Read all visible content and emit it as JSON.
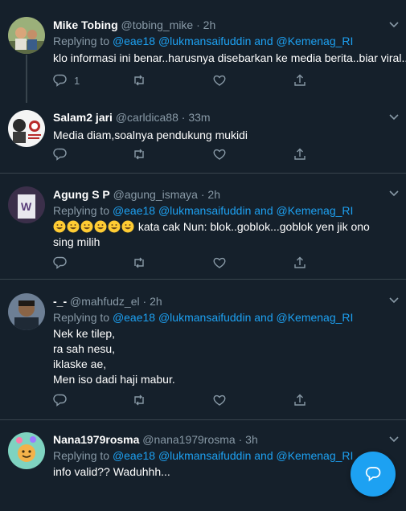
{
  "colors": {
    "background": "#15202b",
    "accent": "#1da1f2",
    "muted": "#8899a6",
    "divider": "#38444d"
  },
  "tweets": [
    {
      "name": "Mike Tobing",
      "handle": "@tobing_mike",
      "separator": "·",
      "time": "2h",
      "replying_prefix": "Replying to",
      "replying_to": "@eae18 @lukmansaifuddin and @Kemenag_RI",
      "lines": [
        "klo informasi ini benar..harusnya disebarkan ke media berita..biar viral.."
      ],
      "reply_count": "1"
    },
    {
      "name": "Salam2 jari",
      "handle": "@carldica88",
      "separator": "·",
      "time": "33m",
      "lines": [
        "Media diam,soalnya pendukung mukidi"
      ]
    },
    {
      "name": "Agung S P",
      "handle": "@agung_ismaya",
      "separator": "·",
      "time": "2h",
      "replying_prefix": "Replying to",
      "replying_to": "@eae18 @lukmansaifuddin and @Kemenag_RI",
      "emoji": [
        "grinning-face-emoji",
        "grinning-face-emoji",
        "grinning-face-emoji",
        "grinning-face-emoji",
        "grinning-face-emoji",
        "grinning-face-emoji"
      ],
      "lines": [
        "kata cak Nun: blok..goblok...goblok yen jik ono",
        "sing milih"
      ]
    },
    {
      "name": "-_-",
      "handle": "@mahfudz_el",
      "separator": "·",
      "time": "2h",
      "replying_prefix": "Replying to",
      "replying_to": "@eae18 @lukmansaifuddin and @Kemenag_RI",
      "lines": [
        "Nek ke tilep,",
        "ra sah nesu,",
        "iklaske ae,",
        "Men iso dadi haji mabur."
      ]
    },
    {
      "name": "Nana1979rosma",
      "handle": "@nana1979rosma",
      "separator": "·",
      "time": "3h",
      "replying_prefix": "Replying to",
      "replying_to": "@eae18 @lukmansaifuddin and @Kemenag_RI",
      "lines": [
        "info valid?? Waduhhh..."
      ]
    }
  ],
  "icons": {
    "reply": "reply-icon",
    "retweet": "retweet-icon",
    "like": "heart-icon",
    "share": "share-icon",
    "more": "chevron-down-icon",
    "compose": "compose-reply-icon"
  }
}
